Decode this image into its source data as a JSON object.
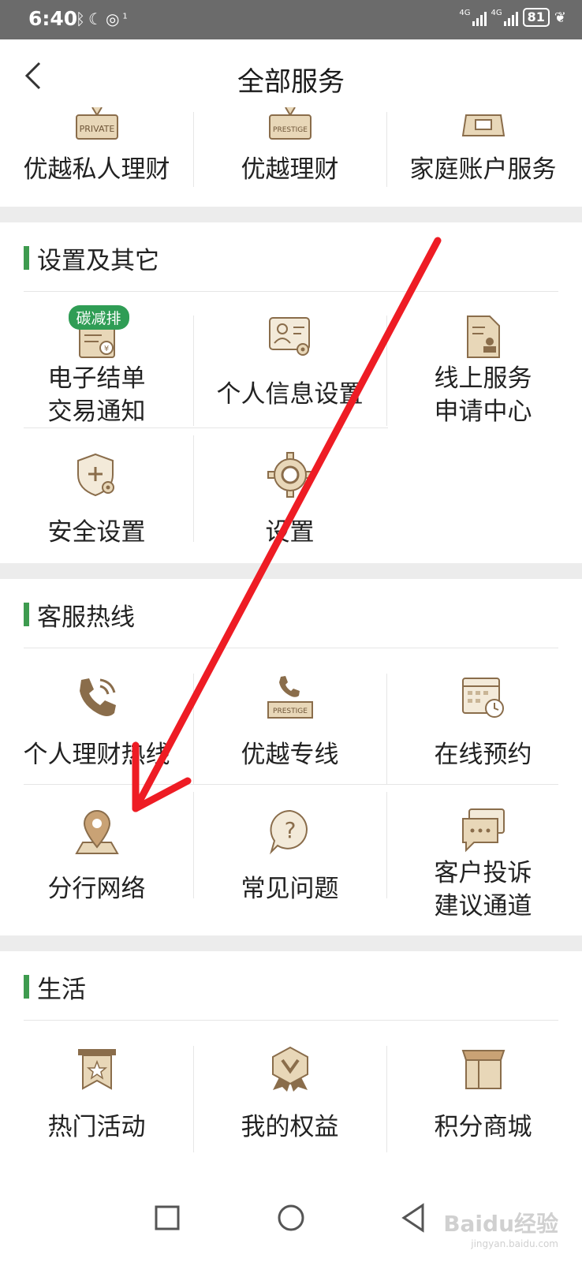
{
  "status_bar": {
    "time": "6:40",
    "left_icons": [
      "bluetooth-icon",
      "moon-icon",
      "hotspot-icon"
    ],
    "hotspot_count": "1",
    "network_1": "4G",
    "network_2": "4G",
    "battery": "81"
  },
  "header": {
    "title": "全部服务",
    "back_icon": "chevron-left-icon"
  },
  "top_partial": {
    "items": [
      {
        "label": "优越私人理财",
        "icon": "private-icon",
        "icon_text": "PRIVATE"
      },
      {
        "label": "优越理财",
        "icon": "prestige-icon",
        "icon_text": "PRESTIGE"
      },
      {
        "label": "家庭账户服务",
        "icon": "family-account-icon"
      }
    ]
  },
  "settings_section": {
    "title": "设置及其它",
    "items": [
      {
        "label_line1": "电子结单",
        "label_line2": "交易通知",
        "icon": "e-statement-icon",
        "badge": "碳减排"
      },
      {
        "label": "个人信息设置",
        "icon": "profile-settings-icon"
      },
      {
        "label_line1": "线上服务",
        "label_line2": "申请中心",
        "icon": "online-service-icon"
      },
      {
        "label": "安全设置",
        "icon": "security-shield-icon"
      },
      {
        "label": "设置",
        "icon": "gear-icon"
      }
    ]
  },
  "hotline_section": {
    "title": "客服热线",
    "items": [
      {
        "label": "个人理财热线",
        "icon": "phone-icon"
      },
      {
        "label": "优越专线",
        "icon": "prestige-phone-icon",
        "icon_text": "PRESTIGE"
      },
      {
        "label": "在线预约",
        "icon": "calendar-clock-icon"
      },
      {
        "label": "分行网络",
        "icon": "location-pin-icon"
      },
      {
        "label": "常见问题",
        "icon": "question-bubble-icon"
      },
      {
        "label_line1": "客户投诉",
        "label_line2": "建议通道",
        "icon": "chat-bubbles-icon"
      }
    ]
  },
  "life_section": {
    "title": "生活",
    "items": [
      {
        "label": "热门活动",
        "icon": "star-banner-icon"
      },
      {
        "label": "我的权益",
        "icon": "badge-v-icon"
      },
      {
        "label": "积分商城",
        "icon": "store-box-icon"
      }
    ]
  },
  "nav_bar": {
    "buttons": [
      "square-recents-icon",
      "circle-home-icon",
      "triangle-back-icon"
    ]
  },
  "watermark": {
    "text": "Baidu经验",
    "sub": "jingyan.baidu.com"
  },
  "colors": {
    "accent_green": "#3e9b4f",
    "icon_brown": "#8a6d4b",
    "icon_tan": "#e8d7b8",
    "annotation_red": "#ee1c24"
  }
}
